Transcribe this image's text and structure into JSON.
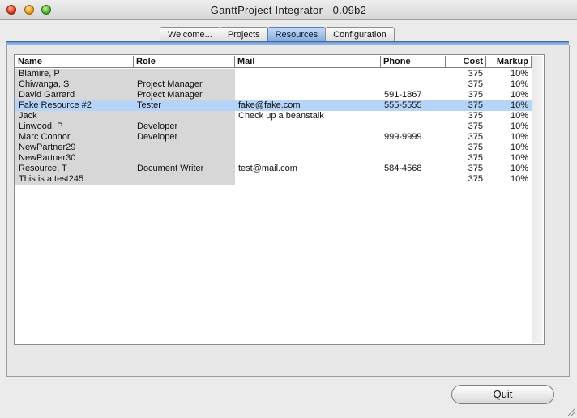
{
  "window": {
    "title": "GanttProject Integrator - 0.09b2"
  },
  "tabs": [
    {
      "label": "Welcome...",
      "active": false
    },
    {
      "label": "Projects",
      "active": false
    },
    {
      "label": "Resources",
      "active": true
    },
    {
      "label": "Configuration",
      "active": false
    }
  ],
  "table": {
    "columns": [
      "Name",
      "Role",
      "Mail",
      "Phone",
      "Cost",
      "Markup"
    ],
    "rows": [
      {
        "name": "Blamire, P",
        "role": "",
        "mail": "",
        "phone": "",
        "cost": "375",
        "markup": "10%"
      },
      {
        "name": "Chiwanga, S",
        "role": "Project Manager",
        "mail": "",
        "phone": "",
        "cost": "375",
        "markup": "10%"
      },
      {
        "name": "David Garrard",
        "role": "Project Manager",
        "mail": "",
        "phone": "591-1867",
        "cost": "375",
        "markup": "10%"
      },
      {
        "name": "Fake Resource #2",
        "role": "Tester",
        "mail": "fake@fake.com",
        "phone": "555-5555",
        "cost": "375",
        "markup": "10%",
        "selected": true
      },
      {
        "name": "Jack",
        "role": "",
        "mail": "Check up a beanstalk",
        "phone": "",
        "cost": "375",
        "markup": "10%"
      },
      {
        "name": "Linwood, P",
        "role": "Developer",
        "mail": "",
        "phone": "",
        "cost": "375",
        "markup": "10%"
      },
      {
        "name": "Marc Connor",
        "role": "Developer",
        "mail": "",
        "phone": "999-9999",
        "cost": "375",
        "markup": "10%"
      },
      {
        "name": "NewPartner29",
        "role": "",
        "mail": "",
        "phone": "",
        "cost": "375",
        "markup": "10%"
      },
      {
        "name": "NewPartner30",
        "role": "",
        "mail": "",
        "phone": "",
        "cost": "375",
        "markup": "10%"
      },
      {
        "name": "Resource, T",
        "role": "Document Writer",
        "mail": "test@mail.com",
        "phone": "584-4568",
        "cost": "375",
        "markup": "10%"
      },
      {
        "name": "This is a test245",
        "role": "",
        "mail": "",
        "phone": "",
        "cost": "375",
        "markup": "10%"
      }
    ]
  },
  "footer": {
    "quit_label": "Quit"
  },
  "icons": {
    "close": "close-traffic-light-icon",
    "minimize": "minimize-traffic-light-icon",
    "zoom": "zoom-traffic-light-icon",
    "resize": "resize-grip-icon"
  },
  "colors": {
    "selected_row": "#b6d3f8",
    "active_tab": "#7ea8de",
    "shaded_column": "#d7d7d7"
  }
}
